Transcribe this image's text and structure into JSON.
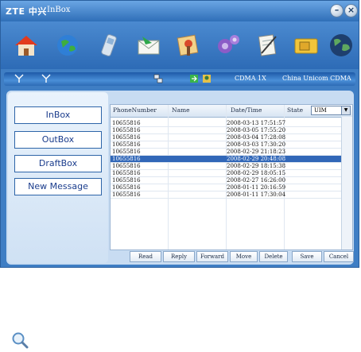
{
  "titlebar": {
    "logo": "ZTE 中兴",
    "title": "InBox"
  },
  "toolbar": {
    "icons": [
      "home-icon",
      "globe-icon",
      "phone-icon",
      "envelope-icon",
      "contacts-icon",
      "gears-icon",
      "notepad-icon",
      "sim-card-icon",
      "world-icon"
    ]
  },
  "statusbar": {
    "network": "CDMA 1X",
    "operator": "China Unicom CDMA"
  },
  "sidebar": {
    "items": [
      {
        "label": "InBox"
      },
      {
        "label": "OutBox"
      },
      {
        "label": "DraftBox"
      },
      {
        "label": "New Message"
      }
    ]
  },
  "table": {
    "columns": [
      "PhoneNumber",
      "Name",
      "Date/Time",
      "State"
    ],
    "storage": "UIM",
    "rows": [
      {
        "phone": "10655816",
        "datetime": "2008-03-13  17:51:57",
        "selected": false
      },
      {
        "phone": "10655816",
        "datetime": "2008-03-05  17:55:20",
        "selected": false
      },
      {
        "phone": "10655816",
        "datetime": "2008-03-04  17:28:08",
        "selected": false
      },
      {
        "phone": "10655816",
        "datetime": "2008-03-03  17:30:20",
        "selected": false
      },
      {
        "phone": "10655816",
        "datetime": "2008-02-29  21:18:23",
        "selected": false
      },
      {
        "phone": "10655816",
        "datetime": "2008-02-29  20:48:08",
        "selected": true
      },
      {
        "phone": "10655816",
        "datetime": "2008-02-29  18:15:38",
        "selected": false
      },
      {
        "phone": "10655816",
        "datetime": "2008-02-29  18:05:15",
        "selected": false
      },
      {
        "phone": "10655816",
        "datetime": "2008-02-27  16:26:00",
        "selected": false
      },
      {
        "phone": "10655816",
        "datetime": "2008-01-11  20:16:59",
        "selected": false
      },
      {
        "phone": "10655816",
        "datetime": "2008-01-11  17:30:04",
        "selected": false
      }
    ]
  },
  "actions": [
    "Read",
    "Reply",
    "Forward",
    "Move",
    "Delete",
    "Save",
    "Cancel"
  ],
  "colors": {
    "frame": "#3f7ec4",
    "selected_row": "#3167b8",
    "button_text": "#1a3c8c"
  }
}
